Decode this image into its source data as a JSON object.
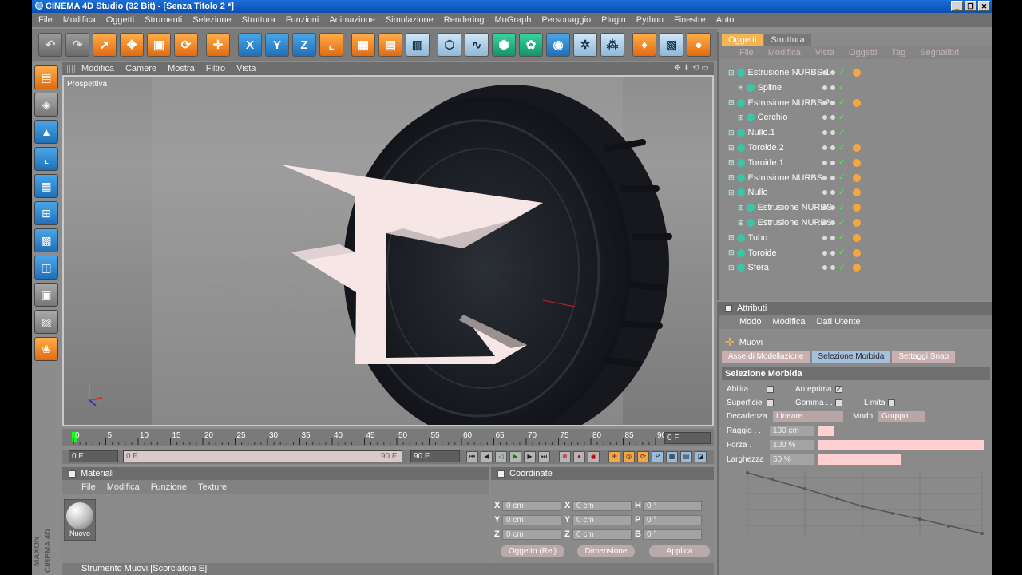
{
  "window": {
    "title": "CINEMA 4D Studio (32 Bit) - [Senza Titolo 2 *]",
    "buttons": [
      "_",
      "❐",
      "✕"
    ]
  },
  "menu": [
    "File",
    "Modifica",
    "Oggetti",
    "Strumenti",
    "Selezione",
    "Struttura",
    "Funzioni",
    "Animazione",
    "Simulazione",
    "Rendering",
    "MoGraph",
    "Personaggio",
    "Plugin",
    "Python",
    "Finestre",
    "Auto"
  ],
  "toolbar": {
    "icons": [
      "undo-icon",
      "redo-icon",
      "select-icon",
      "move-icon",
      "scale-icon",
      "rotate-icon",
      "live-move-icon",
      "x-axis-icon",
      "y-axis-icon",
      "z-axis-icon",
      "coord-system-icon",
      "render-view-icon",
      "render-picture-icon",
      "render-settings-icon",
      "cube-icon",
      "spline-icon",
      "nurbs-icon",
      "array-icon",
      "deformer-icon",
      "scene-icon",
      "effector-icon",
      "light-icon",
      "camera-icon",
      "record-icon"
    ],
    "axes": [
      "X",
      "Y",
      "Z"
    ]
  },
  "viewport": {
    "menu": [
      "Modifica",
      "Camere",
      "Mostra",
      "Filtro",
      "Vista"
    ],
    "label": "Prospettiva"
  },
  "timeline": {
    "ticks": [
      "0",
      "5",
      "10",
      "15",
      "20",
      "25",
      "30",
      "35",
      "40",
      "45",
      "50",
      "55",
      "60",
      "65",
      "70",
      "75",
      "80",
      "85",
      "90"
    ],
    "current": "0 F"
  },
  "transport": {
    "start": "0 F",
    "range_start": "0 F",
    "range_end": "90 F",
    "end": "90 F"
  },
  "materials": {
    "title": "Materiali",
    "menu": [
      "File",
      "Modifica",
      "Funzione",
      "Texture"
    ],
    "item": "Nuovo"
  },
  "coordinates": {
    "title": "Coordinate",
    "rows": [
      {
        "a": "X",
        "av": "0 cm",
        "b": "X",
        "bv": "0 cm",
        "c": "H",
        "cv": "0 °"
      },
      {
        "a": "Y",
        "av": "0 cm",
        "b": "Y",
        "bv": "0 cm",
        "c": "P",
        "cv": "0 °"
      },
      {
        "a": "Z",
        "av": "0 cm",
        "b": "Z",
        "bv": "0 cm",
        "c": "B",
        "cv": "0 °"
      }
    ],
    "mode": "Oggetto (Rel)",
    "dim": "Dimensione",
    "apply": "Applica"
  },
  "objects": {
    "tabs": [
      "Oggetti",
      "Struttura"
    ],
    "menu": [
      "File",
      "Modifica",
      "Vista",
      "Oggetti",
      "Tag",
      "Segnalibri"
    ],
    "items": [
      {
        "name": "Estrusione NURBS.1",
        "indent": 0,
        "tag": true
      },
      {
        "name": "Spline",
        "indent": 1,
        "tag": false
      },
      {
        "name": "Estrusione NURBS.2",
        "indent": 0,
        "tag": true
      },
      {
        "name": "Cerchio",
        "indent": 1,
        "tag": false
      },
      {
        "name": "Nullo.1",
        "indent": 0,
        "tag": false
      },
      {
        "name": "Toroide.2",
        "indent": 0,
        "tag": true
      },
      {
        "name": "Toroide.1",
        "indent": 0,
        "tag": true
      },
      {
        "name": "Estrusione NURBS",
        "indent": 0,
        "tag": true
      },
      {
        "name": "Nullo",
        "indent": 0,
        "tag": true
      },
      {
        "name": "Estrusione NURBS",
        "indent": 1,
        "tag": true
      },
      {
        "name": "Estrusione NURBS",
        "indent": 1,
        "tag": true
      },
      {
        "name": "Tubo",
        "indent": 0,
        "tag": true
      },
      {
        "name": "Toroide",
        "indent": 0,
        "tag": true
      },
      {
        "name": "Sfera",
        "indent": 0,
        "tag": true
      }
    ]
  },
  "attributes": {
    "title": "Attributi",
    "menu": [
      "Modo",
      "Modifica",
      "Dati Utente"
    ],
    "tool": "Muovi",
    "tabs": [
      "Asse di Modellazione",
      "Selezione Morbida",
      "Settaggi Snap"
    ],
    "section": "Selezione Morbida",
    "labels": {
      "abilita": "Abilita .",
      "anteprima": "Anteprima",
      "superficie": "Superficie",
      "gomma": "Gomma . .",
      "limita": "Limita",
      "decadenza": "Decadenza",
      "modo": "Modo",
      "raggio": "Raggio . .",
      "forza": "Forza . .",
      "larghezza": "Larghezza"
    },
    "values": {
      "decadenza": "Lineare",
      "modo": "Gruppo",
      "raggio": "100 cm",
      "forza": "100 %",
      "larghezza": "50 %"
    }
  },
  "status": "Strumento Muovi [Scorciatoia E]"
}
